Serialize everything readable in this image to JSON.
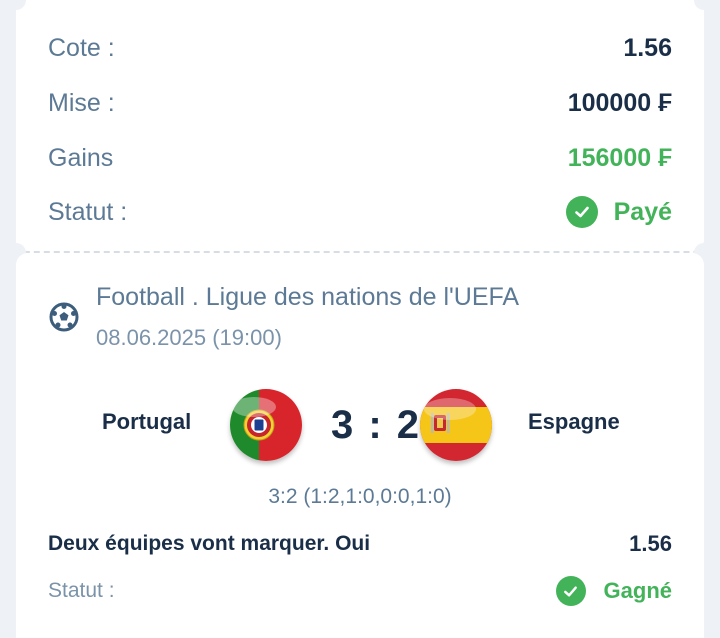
{
  "summary": {
    "odds_label": "Cote :",
    "odds_value": "1.56",
    "stake_label": "Mise :",
    "stake_value": "100000 ₣",
    "winnings_label": "Gains",
    "winnings_value": "156000 ₣",
    "status_label": "Statut :",
    "status_value": "Payé"
  },
  "event": {
    "league": "Football . Ligue des nations de l'UEFA",
    "date": "08.06.2025 (19:00)",
    "home_team": "Portugal",
    "away_team": "Espagne",
    "score": "3 : 2",
    "period_scores": "3:2 (1:2,1:0,0:0,1:0)",
    "bet_name": "Deux équipes vont marquer. Oui",
    "bet_odds": "1.56",
    "status_label": "Statut :",
    "status_value": "Gagné"
  },
  "colors": {
    "background": "#eef1f5",
    "text_dark": "#1a2e48",
    "text_muted": "#5c7a95",
    "success": "#43b35a"
  },
  "icons": {
    "status_icon": "check-circle-icon",
    "sport_icon": "soccer-ball-icon",
    "home_flag": "portugal-flag-icon",
    "away_flag": "spain-flag-icon"
  }
}
